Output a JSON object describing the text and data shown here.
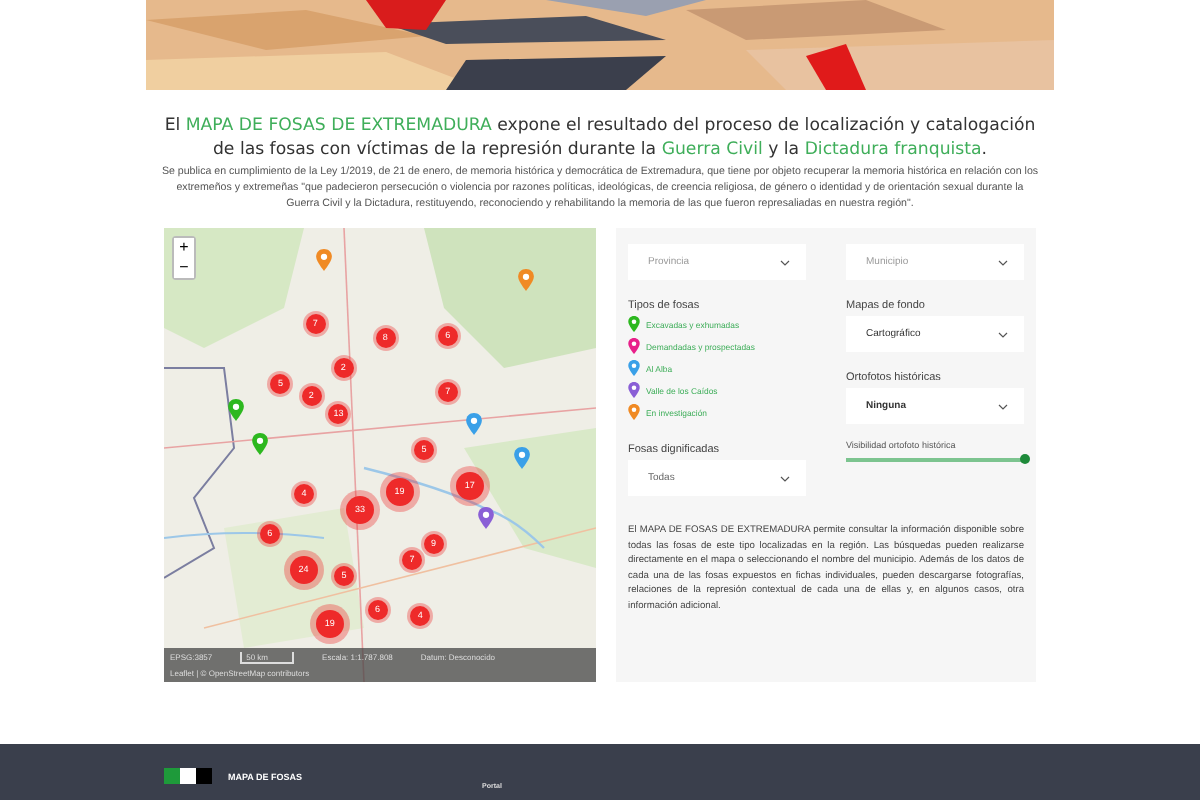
{
  "intro": {
    "heading": "El **MAPA DE FOSAS DE EXTREMADURA** expone el resultado del proceso de localización y catalogación de las fosas con víctimas de la represión durante la **Guerra Civil** y la **Dictadura franquista**.",
    "body": "Se publica en cumplimiento de la Ley 1/2019, de 21 de enero, de memoria histórica y democrática de Extremadura, que tiene por objeto recuperar la memoria histórica en relación con los extremeños y extremeñas \"que padecieron persecución o violencia por razones políticas, ideológicas, de creencia religiosa, de género o identidad y de orientación sexual durante la Guerra Civil y la Dictadura, restituyendo, reconociendo y rehabilitando la memoria de las que fueron represaliadas en nuestra región\"."
  },
  "map": {
    "zoom_in": "+",
    "zoom_out": "−",
    "clusters": [
      {
        "label": "7",
        "kind": "small"
      },
      {
        "label": "8",
        "kind": "small"
      },
      {
        "label": "6",
        "kind": "small"
      },
      {
        "label": "2",
        "kind": "small"
      },
      {
        "label": "5",
        "kind": "small"
      },
      {
        "label": "2",
        "kind": "small"
      },
      {
        "label": "7",
        "kind": "small"
      },
      {
        "label": "13",
        "kind": "small"
      },
      {
        "label": "5",
        "kind": "small"
      },
      {
        "label": "4",
        "kind": "small"
      },
      {
        "label": "33",
        "kind": "large"
      },
      {
        "label": "19",
        "kind": "large"
      },
      {
        "label": "17",
        "kind": "large"
      },
      {
        "label": "6",
        "kind": "small"
      },
      {
        "label": "9",
        "kind": "small"
      },
      {
        "label": "7",
        "kind": "small"
      },
      {
        "label": "24",
        "kind": "large"
      },
      {
        "label": "5",
        "kind": "small"
      },
      {
        "label": "6",
        "kind": "small"
      },
      {
        "label": "4",
        "kind": "small"
      },
      {
        "label": "19",
        "kind": "large"
      }
    ],
    "pins": [
      {
        "color": "#f08a24"
      },
      {
        "color": "#f08a24"
      },
      {
        "color": "#2db81f"
      },
      {
        "color": "#2db81f"
      },
      {
        "color": "#3aa0e8"
      },
      {
        "color": "#3aa0e8"
      },
      {
        "color": "#8a5fd6"
      }
    ],
    "footer": {
      "projection": "EPSG:3857",
      "scale_bar": "50 km",
      "scale": "Escala: 1:1.787.808",
      "datum": "Datum: Desconocido",
      "attribution": "Leaflet | © OpenStreetMap contributors"
    }
  },
  "filters": {
    "province": {
      "placeholder": "Provincia"
    },
    "municipality": {
      "placeholder": "Municipio"
    },
    "types_title": "Tipos de fosas",
    "types": [
      {
        "label": "Excavadas y exhumadas",
        "color": "#2db81f"
      },
      {
        "label": "Demandadas y prospectadas",
        "color": "#e8208a"
      },
      {
        "label": "Al Alba",
        "color": "#3aa0e8"
      },
      {
        "label": "Valle de los Caídos",
        "color": "#8a5fd6"
      },
      {
        "label": "En investigación",
        "color": "#f08a24"
      }
    ],
    "basemap": {
      "label": "Mapas de fondo",
      "value": "Cartográfico"
    },
    "orthophoto": {
      "label": "Ortofotos históricas",
      "value": "Ninguna"
    },
    "dignified": {
      "label": "Fosas dignificadas",
      "value": "Todas"
    },
    "visibility": {
      "label": "Visibilidad ortofoto histórica",
      "level": 1
    },
    "description": "El MAPA DE FOSAS DE EXTREMADURA permite consultar la información disponible sobre todas las fosas de este tipo localizadas en la región. Las búsquedas pueden realizarse directamente en el mapa o seleccionando el nombre del municipio. Además de los datos de cada una de las fosas expuestos en fichas individuales, pueden descargarse fotografías, relaciones de la represión contextual de cada una de ellas y, en algunos casos, otra información adicional."
  },
  "footer": {
    "brand": "MAPA DE FOSAS",
    "link": "Portal"
  }
}
